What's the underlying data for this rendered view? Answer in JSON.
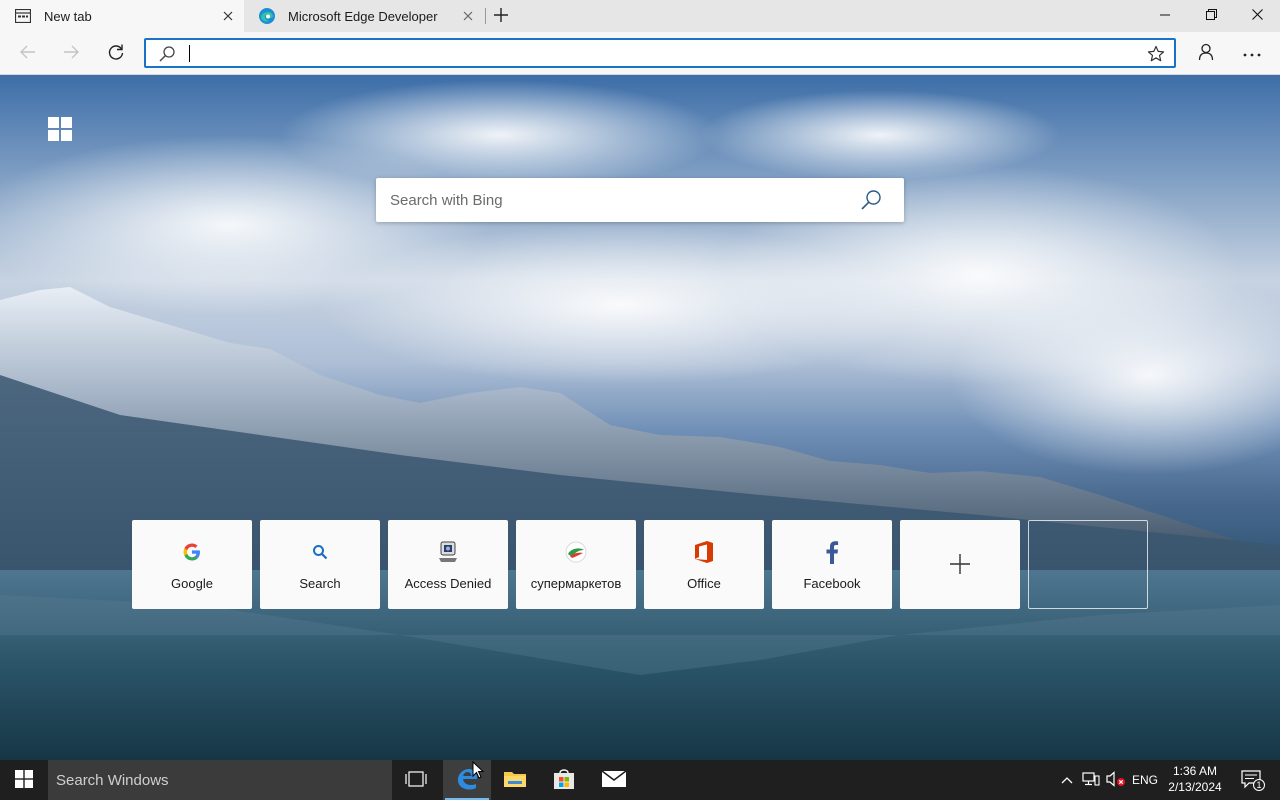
{
  "browser": {
    "tabs": [
      {
        "title": "New tab",
        "icon": "newtab-page-icon",
        "active": true
      },
      {
        "title": "Microsoft Edge Developer",
        "icon": "edge-icon",
        "active": false
      }
    ],
    "address_bar": {
      "value": "",
      "placeholder": ""
    }
  },
  "newtab": {
    "search_placeholder": "Search with Bing",
    "top_sites": [
      {
        "label": "Google",
        "icon": "google-icon"
      },
      {
        "label": "Search",
        "icon": "search-icon"
      },
      {
        "label": "Access Denied",
        "icon": "access-denied-icon"
      },
      {
        "label": "супермаркетов",
        "icon": "supermarket-icon"
      },
      {
        "label": "Office",
        "icon": "office-icon"
      },
      {
        "label": "Facebook",
        "icon": "facebook-icon"
      }
    ]
  },
  "taskbar": {
    "search_text": "Search Windows",
    "language": "ENG",
    "time": "1:36 AM",
    "date": "2/13/2024",
    "notification_count": "1",
    "apps": [
      "task-view-icon",
      "edge-icon",
      "file-explorer-icon",
      "store-icon",
      "mail-icon"
    ]
  },
  "colors": {
    "accent": "#1a73c9",
    "taskbar": "#1f1f1f",
    "tab_strip": "#e6e6e6",
    "toolbar": "#f7f7f7"
  }
}
